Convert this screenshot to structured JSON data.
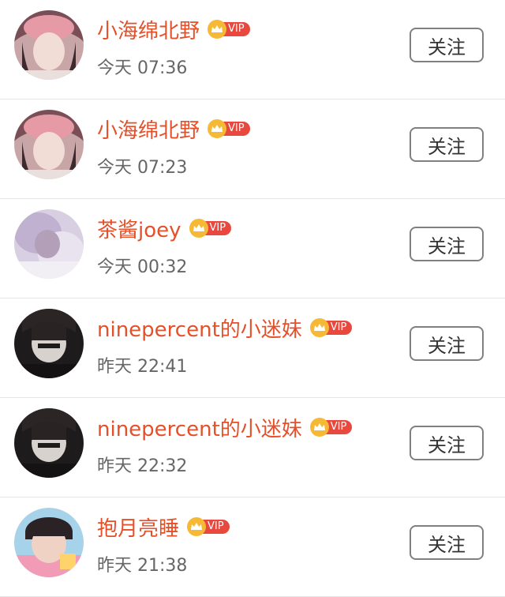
{
  "follow_label": "关注",
  "vip_label": "VIP",
  "users": [
    {
      "name": "小海绵北野",
      "time": "今天 07:36",
      "avatar": "avatar-girl-pink-hat"
    },
    {
      "name": "小海绵北野",
      "time": "今天 07:23",
      "avatar": "avatar-girl-pink-hat"
    },
    {
      "name": "茶酱joey",
      "time": "今天 00:32",
      "avatar": "avatar-blurred-lavender"
    },
    {
      "name": "ninepercent的小迷妹",
      "time": "昨天 22:41",
      "avatar": "avatar-dark-hair"
    },
    {
      "name": "ninepercent的小迷妹",
      "time": "昨天 22:32",
      "avatar": "avatar-dark-hair"
    },
    {
      "name": "抱月亮睡",
      "time": "昨天 21:38",
      "avatar": "avatar-boy-colorful"
    }
  ],
  "colors": {
    "name": "#e4502a",
    "vip_tag": "#e8483d",
    "crown": "#f6b935",
    "time": "#666666"
  }
}
